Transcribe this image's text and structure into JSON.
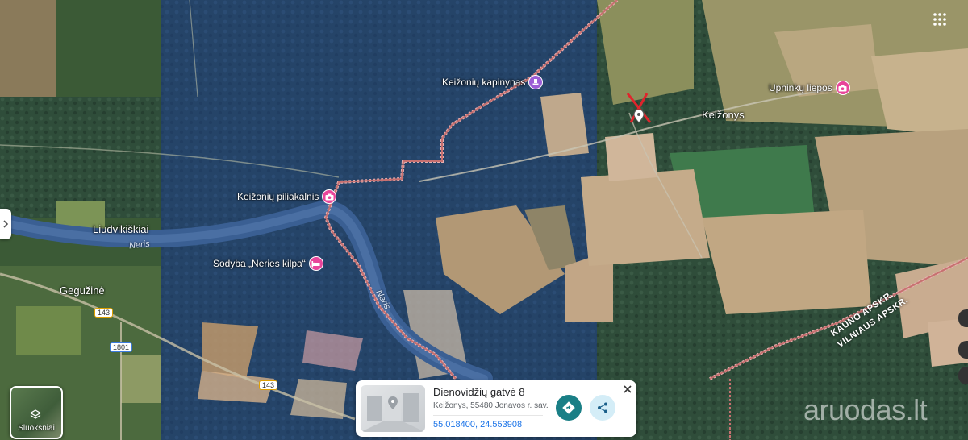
{
  "map": {
    "places": {
      "keizonys": "Keižonys",
      "liudvikiskiai": "Liudvikiškiai",
      "guzine": "Gegužinė"
    },
    "pois": {
      "kapinynas": "Keižonių kapinynas",
      "upninku_liepos": "Upninkų liepos",
      "piliakalnis": "Keižonių piliakalnis",
      "sodyba": "Sodyba „Neries kilpa“"
    },
    "rivers": [
      "Neris",
      "Neris"
    ],
    "roads": [
      "143",
      "1801",
      "143"
    ],
    "admin_labels": [
      "KAUNO APSKR.",
      "VILNIAUS APSKR."
    ],
    "colors": {
      "poi_pink": "#e8459a",
      "poi_purple": "#9c5dd6",
      "boundary": "#d88a8a",
      "marker_cross": "#e0242c",
      "direction_button": "#1a7f86"
    }
  },
  "layers_button": {
    "label": "Sluoksniai",
    "icon": "layers-icon"
  },
  "place_card": {
    "title": "Dienovidžių gatvė 8",
    "address": "Keižonys, 55480 Jonavos r. sav.",
    "coordinates": "55.018400, 24.553908",
    "icons": {
      "directions": "directions-icon",
      "share": "share-icon",
      "close": "close-icon"
    }
  },
  "watermark": "aruodas.lt",
  "apps_icon": "apps-grid-icon"
}
